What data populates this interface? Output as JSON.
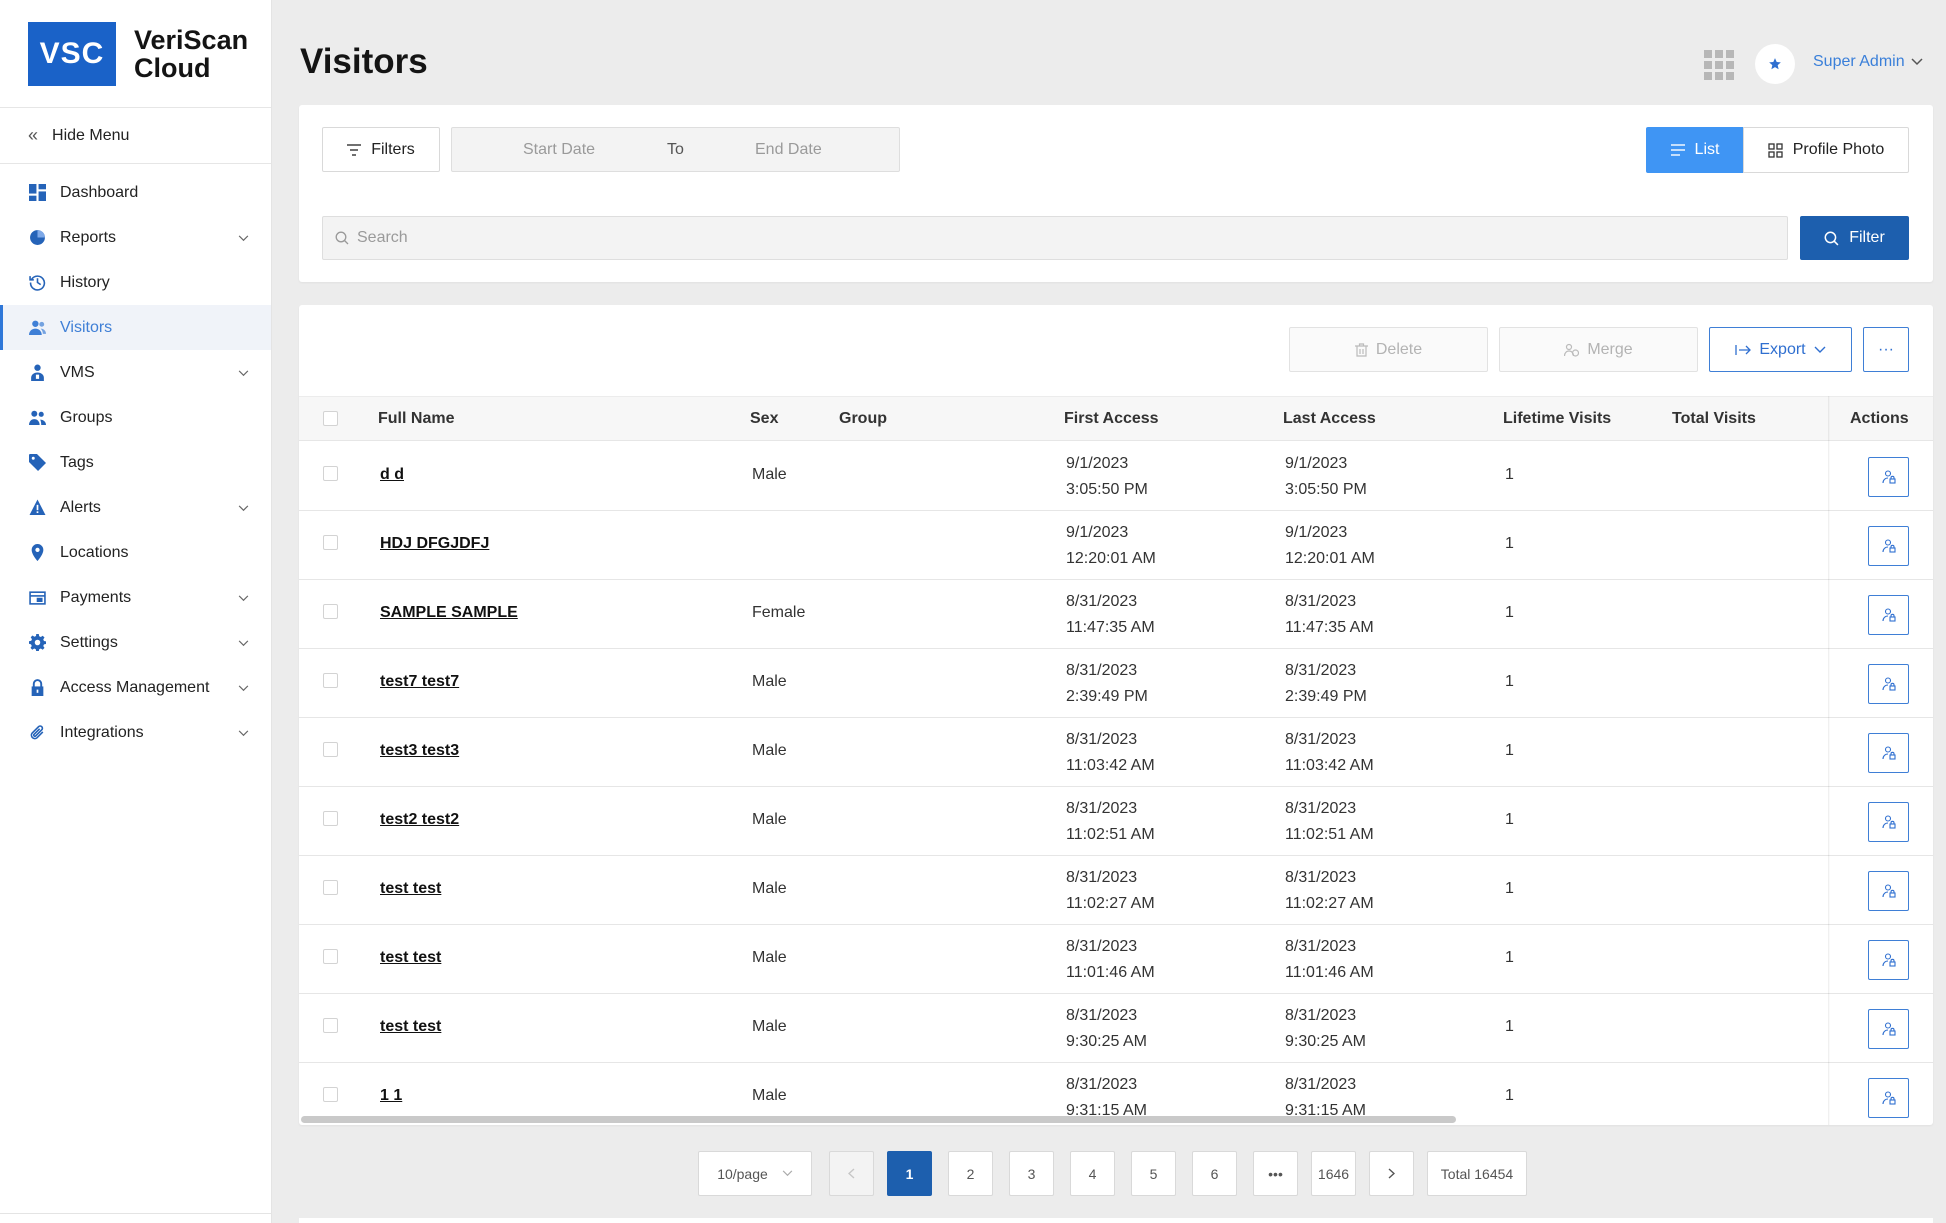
{
  "logo": {
    "badge": "VSC",
    "line1": "VeriScan",
    "line2": "Cloud"
  },
  "sidebar": {
    "hide_menu": "Hide Menu",
    "items": [
      {
        "label": "Dashboard",
        "icon": "dashboard-icon",
        "expandable": false,
        "active": false
      },
      {
        "label": "Reports",
        "icon": "pie-chart-icon",
        "expandable": true,
        "active": false
      },
      {
        "label": "History",
        "icon": "history-icon",
        "expandable": false,
        "active": false
      },
      {
        "label": "Visitors",
        "icon": "users-icon",
        "expandable": false,
        "active": true
      },
      {
        "label": "VMS",
        "icon": "person-badge-icon",
        "expandable": true,
        "active": false
      },
      {
        "label": "Groups",
        "icon": "group-icon",
        "expandable": false,
        "active": false
      },
      {
        "label": "Tags",
        "icon": "tag-icon",
        "expandable": false,
        "active": false
      },
      {
        "label": "Alerts",
        "icon": "warning-icon",
        "expandable": true,
        "active": false
      },
      {
        "label": "Locations",
        "icon": "location-pin-icon",
        "expandable": false,
        "active": false
      },
      {
        "label": "Payments",
        "icon": "payment-icon",
        "expandable": true,
        "active": false
      },
      {
        "label": "Settings",
        "icon": "gear-icon",
        "expandable": true,
        "active": false
      },
      {
        "label": "Access Management",
        "icon": "lock-icon",
        "expandable": true,
        "active": false
      },
      {
        "label": "Integrations",
        "icon": "paperclip-icon",
        "expandable": true,
        "active": false
      }
    ]
  },
  "header": {
    "title": "Visitors",
    "user": "Super Admin"
  },
  "filters": {
    "filters_label": "Filters",
    "start_date_placeholder": "Start Date",
    "to_label": "To",
    "end_date_placeholder": "End Date",
    "view_list": "List",
    "view_photo": "Profile Photo",
    "search_placeholder": "Search",
    "filter_button": "Filter"
  },
  "toolbar": {
    "delete": "Delete",
    "merge": "Merge",
    "export": "Export",
    "more": "···"
  },
  "table": {
    "columns": [
      "Full Name",
      "Sex",
      "Group",
      "First Access",
      "Last Access",
      "Lifetime Visits",
      "Total Visits",
      "Actions"
    ],
    "rows": [
      {
        "name": "d d",
        "sex": "Male",
        "group": "",
        "first_date": "9/1/2023",
        "first_time": "3:05:50 PM",
        "last_date": "9/1/2023",
        "last_time": "3:05:50 PM",
        "lifetime": "1",
        "total": ""
      },
      {
        "name": "HDJ DFGJDFJ",
        "sex": "",
        "group": "",
        "first_date": "9/1/2023",
        "first_time": "12:20:01 AM",
        "last_date": "9/1/2023",
        "last_time": "12:20:01 AM",
        "lifetime": "1",
        "total": ""
      },
      {
        "name": "SAMPLE SAMPLE",
        "sex": "Female",
        "group": "",
        "first_date": "8/31/2023",
        "first_time": "11:47:35 AM",
        "last_date": "8/31/2023",
        "last_time": "11:47:35 AM",
        "lifetime": "1",
        "total": ""
      },
      {
        "name": "test7 test7",
        "sex": "Male",
        "group": "",
        "first_date": "8/31/2023",
        "first_time": "2:39:49 PM",
        "last_date": "8/31/2023",
        "last_time": "2:39:49 PM",
        "lifetime": "1",
        "total": ""
      },
      {
        "name": "test3 test3",
        "sex": "Male",
        "group": "",
        "first_date": "8/31/2023",
        "first_time": "11:03:42 AM",
        "last_date": "8/31/2023",
        "last_time": "11:03:42 AM",
        "lifetime": "1",
        "total": ""
      },
      {
        "name": "test2 test2",
        "sex": "Male",
        "group": "",
        "first_date": "8/31/2023",
        "first_time": "11:02:51 AM",
        "last_date": "8/31/2023",
        "last_time": "11:02:51 AM",
        "lifetime": "1",
        "total": ""
      },
      {
        "name": "test test",
        "sex": "Male",
        "group": "",
        "first_date": "8/31/2023",
        "first_time": "11:02:27 AM",
        "last_date": "8/31/2023",
        "last_time": "11:02:27 AM",
        "lifetime": "1",
        "total": ""
      },
      {
        "name": "test test",
        "sex": "Male",
        "group": "",
        "first_date": "8/31/2023",
        "first_time": "11:01:46 AM",
        "last_date": "8/31/2023",
        "last_time": "11:01:46 AM",
        "lifetime": "1",
        "total": ""
      },
      {
        "name": "test test",
        "sex": "Male",
        "group": "",
        "first_date": "8/31/2023",
        "first_time": "9:30:25 AM",
        "last_date": "8/31/2023",
        "last_time": "9:30:25 AM",
        "lifetime": "1",
        "total": ""
      },
      {
        "name": "1 1",
        "sex": "Male",
        "group": "",
        "first_date": "8/31/2023",
        "first_time": "9:31:15 AM",
        "last_date": "8/31/2023",
        "last_time": "9:31:15 AM",
        "lifetime": "1",
        "total": ""
      }
    ]
  },
  "pagination": {
    "page_size": "10/page",
    "pages": [
      "1",
      "2",
      "3",
      "4",
      "5",
      "6",
      "•••",
      "1646"
    ],
    "current": "1",
    "total": "Total 16454"
  },
  "colors": {
    "accent": "#3f95f4",
    "primary": "#1d5fae",
    "logo": "#1a62c8",
    "link": "#3a7fd9"
  }
}
